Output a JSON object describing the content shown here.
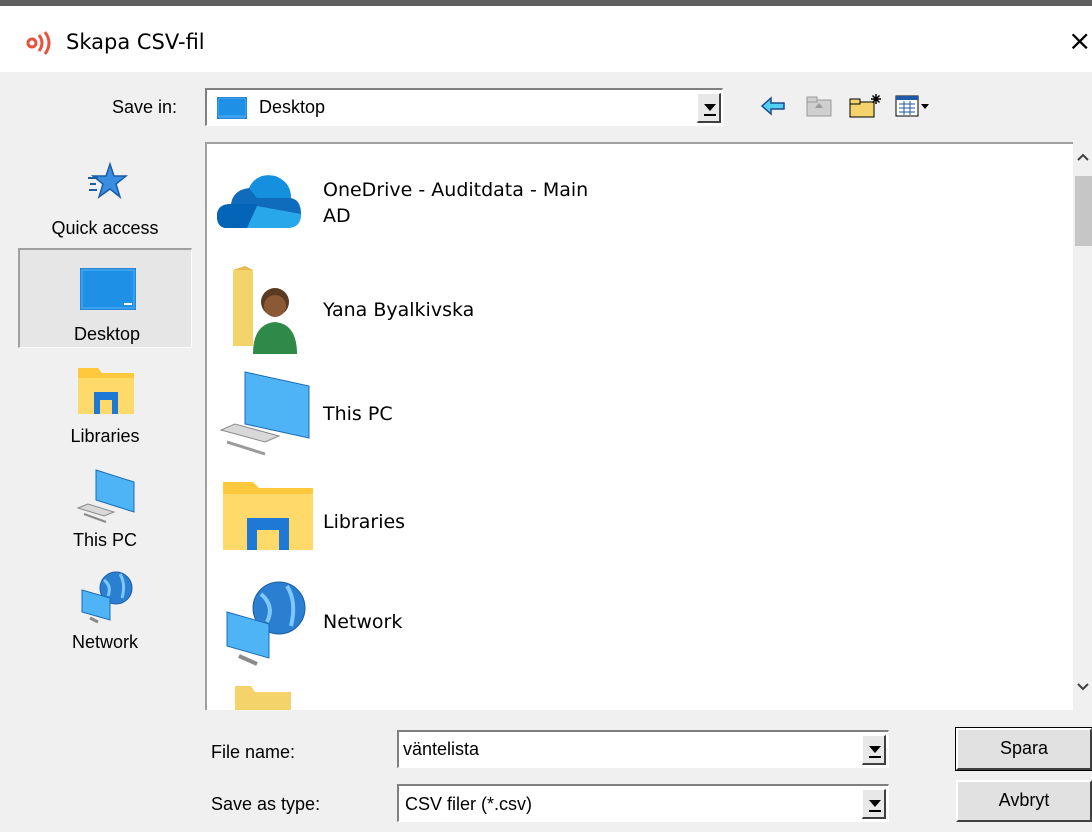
{
  "window": {
    "title": "Skapa CSV-fil",
    "close_glyph": "×"
  },
  "toolbar": {
    "save_in_label": "Save in:",
    "save_in_value": "Desktop",
    "icons": [
      "back-arrow-icon",
      "up-folder-icon",
      "new-folder-icon",
      "view-menu-icon"
    ]
  },
  "places": [
    {
      "label": "Quick access",
      "icon": "star-icon"
    },
    {
      "label": "Desktop",
      "icon": "desktop-icon",
      "selected": true
    },
    {
      "label": "Libraries",
      "icon": "libraries-icon"
    },
    {
      "label": "This PC",
      "icon": "computer-icon"
    },
    {
      "label": "Network",
      "icon": "network-icon"
    }
  ],
  "files": [
    {
      "line1": "OneDrive - Auditdata - Main",
      "line2": "AD",
      "icon": "onedrive-cloud-icon"
    },
    {
      "line1": "Yana Byalkivska",
      "icon": "user-folder-icon"
    },
    {
      "line1": "This PC",
      "icon": "computer-icon"
    },
    {
      "line1": "Libraries",
      "icon": "libraries-icon"
    },
    {
      "line1": "Network",
      "icon": "network-icon"
    }
  ],
  "form": {
    "file_name_label": "File name:",
    "file_name_value": "väntelista",
    "save_as_type_label": "Save as type:",
    "save_as_type_value": "CSV filer (*.csv)"
  },
  "buttons": {
    "save": "Spara",
    "cancel": "Avbryt"
  },
  "colors": {
    "accent": "#e5533c",
    "selection": "#e6e6e6",
    "folder": "#ffc83d",
    "monitor": "#1e90e6"
  }
}
